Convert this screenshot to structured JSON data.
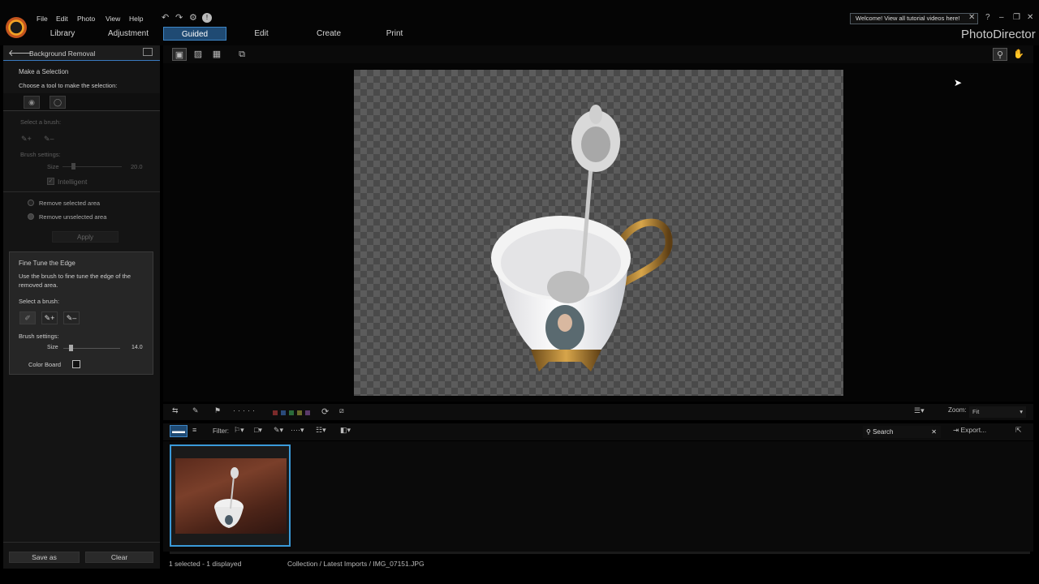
{
  "menu": {
    "file": "File",
    "edit": "Edit",
    "photo": "Photo",
    "view": "View",
    "help": "Help"
  },
  "modes": {
    "library": "Library",
    "adjustment": "Adjustment",
    "guided": "Guided",
    "edit": "Edit",
    "create": "Create",
    "print": "Print"
  },
  "welcome": "Welcome! View all tutorial videos here!",
  "brand": "PhotoDirector",
  "panel": {
    "title": "Background Removal",
    "make_selection": "Make a Selection",
    "choose_tool": "Choose a tool to make the selection:",
    "select_brush": "Select a brush:",
    "brush_settings": "Brush settings:",
    "size_label": "Size",
    "size_value": "20.0",
    "intelligent": "Intelligent",
    "remove_selected": "Remove selected area",
    "remove_unselected": "Remove unselected area",
    "apply": "Apply",
    "fine_tune_title": "Fine Tune the Edge",
    "fine_tune_desc": "Use the brush to fine tune the edge of the removed area.",
    "select_brush2": "Select a brush:",
    "brush_settings2": "Brush settings:",
    "size_label2": "Size",
    "size_value2": "14.0",
    "color_board": "Color Board",
    "save_as": "Save as",
    "clear": "Clear"
  },
  "filmstrip": {
    "filter_label": "Filter:",
    "zoom_label": "Zoom:",
    "zoom_value": "Fit",
    "search_placeholder": "Search",
    "export": "Export..."
  },
  "status": {
    "selection": "1 selected - 1 displayed",
    "path": "Collection / Latest Imports / IMG_07151.JPG"
  },
  "colors": {
    "accent": "#3a9ad9",
    "active_tab": "#1f4a73",
    "background": "#000000"
  }
}
